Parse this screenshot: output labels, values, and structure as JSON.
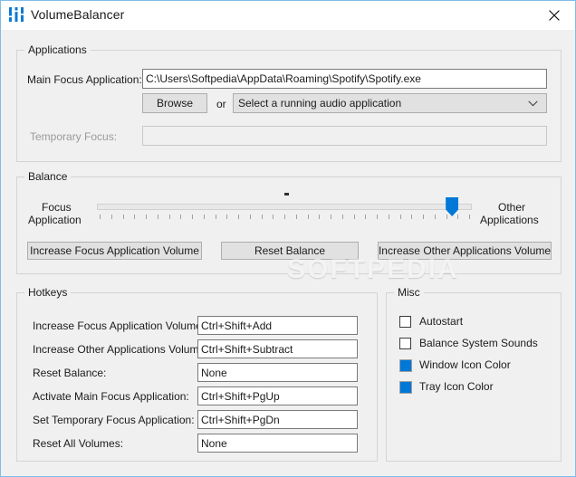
{
  "window": {
    "title": "VolumeBalancer",
    "app_icon": "sliders-icon",
    "close_icon": "close-icon",
    "accent_color": "#0078d7",
    "border_color": "#7fbce8",
    "background_color": "#f0f0f0"
  },
  "watermark": {
    "text": "SOFTPEDIA"
  },
  "applications": {
    "group_title": "Applications",
    "main_focus_label": "Main Focus Application:",
    "main_focus_value": "C:\\Users\\Softpedia\\AppData\\Roaming\\Spotify\\Spotify.exe",
    "browse_label": "Browse",
    "or_label": "or",
    "combo_value": "Select a running audio application",
    "combo_icon": "chevron-down-icon",
    "temporary_focus_label": "Temporary Focus:",
    "temporary_focus_value": "",
    "temporary_focus_disabled": true
  },
  "balance": {
    "group_title": "Balance",
    "left_label_line1": "Focus",
    "left_label_line2": "Application",
    "right_label_line1": "Other",
    "right_label_line2": "Applications",
    "slider_value_percent": 94,
    "slider_min": 0,
    "slider_max": 100,
    "tick_count": 33,
    "buttons": [
      {
        "label": "Increase Focus Application Volume",
        "name": "increase-focus-application-volume-button"
      },
      {
        "label": "Reset Balance",
        "name": "reset-balance-button"
      },
      {
        "label": "Increase Other Applications Volume",
        "name": "increase-other-applications-volume-button"
      }
    ]
  },
  "hotkeys": {
    "group_title": "Hotkeys",
    "rows": [
      {
        "label": "Increase Focus Application Volume:",
        "value": "Ctrl+Shift+Add",
        "name": "hotkey-increase-focus-application-volume"
      },
      {
        "label": "Increase Other Applications Volume:",
        "value": "Ctrl+Shift+Subtract",
        "name": "hotkey-increase-other-applications-volume"
      },
      {
        "label": "Reset Balance:",
        "value": "None",
        "name": "hotkey-reset-balance"
      },
      {
        "label": "Activate Main Focus Application:",
        "value": "Ctrl+Shift+PgUp",
        "name": "hotkey-activate-main-focus-application"
      },
      {
        "label": "Set Temporary Focus Application:",
        "value": "Ctrl+Shift+PgDn",
        "name": "hotkey-set-temporary-focus-application"
      },
      {
        "label": "Reset All Volumes:",
        "value": "None",
        "name": "hotkey-reset-all-volumes"
      }
    ]
  },
  "misc": {
    "group_title": "Misc",
    "items": [
      {
        "label": "Autostart",
        "type": "checkbox",
        "checked": false,
        "name": "autostart-checkbox"
      },
      {
        "label": "Balance System Sounds",
        "type": "checkbox",
        "checked": false,
        "name": "balance-system-sounds-checkbox"
      },
      {
        "label": "Window Icon Color",
        "type": "swatch",
        "color": "#0078d7",
        "name": "window-icon-color-swatch"
      },
      {
        "label": "Tray Icon Color",
        "type": "swatch",
        "color": "#0078d7",
        "name": "tray-icon-color-swatch"
      }
    ]
  }
}
